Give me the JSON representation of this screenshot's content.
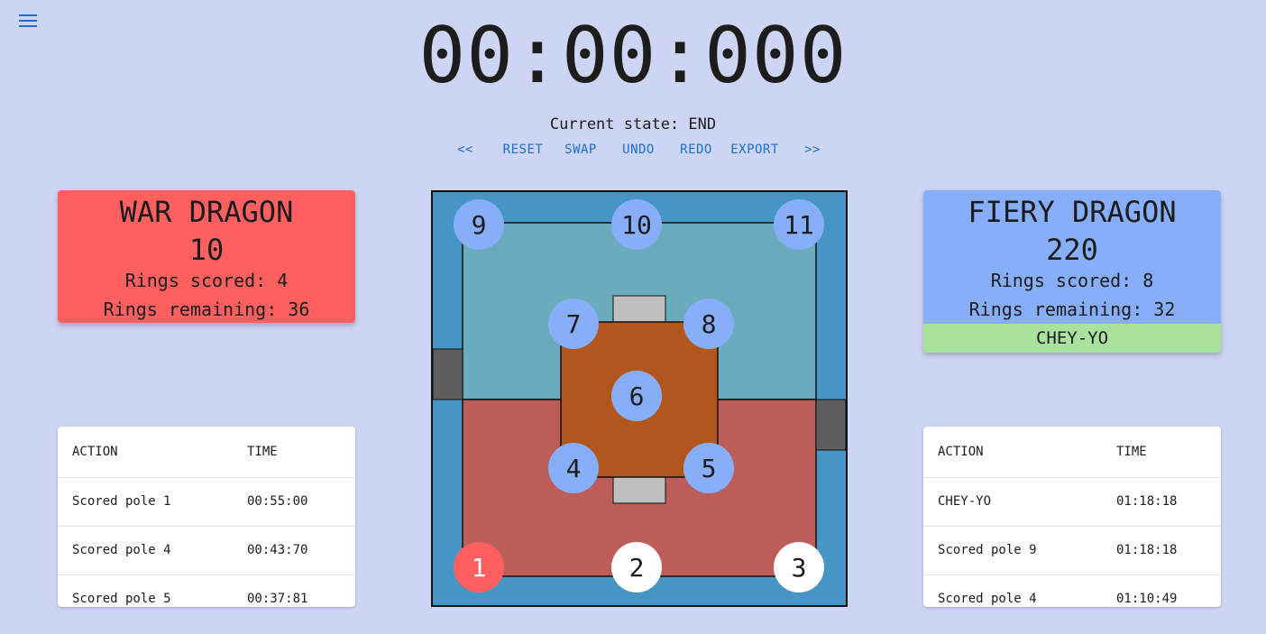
{
  "timer": "00:00:000",
  "state_text": "Current state: END",
  "controls": {
    "prev": "<<",
    "reset": "RESET",
    "swap": "SWAP",
    "undo": "UNDO",
    "redo": "REDO",
    "export": "EXPORT",
    "next": ">>"
  },
  "colors": {
    "background": "#cdd5f4",
    "red_team": "#fe5f5f",
    "blue_team": "#87aef8",
    "accent": "#1e6fce",
    "badge": "#a8e29c"
  },
  "menu_icon": "hamburger-menu-icon",
  "red_team": {
    "name": "WAR DRAGON",
    "score": "10",
    "rings_scored": "Rings scored: 4",
    "rings_remaining": "Rings remaining: 36"
  },
  "blue_team": {
    "name": "FIERY DRAGON",
    "score": "220",
    "rings_scored": "Rings scored: 8",
    "rings_remaining": "Rings remaining: 32",
    "badge": "CHEY-YO"
  },
  "red_log": {
    "headers": [
      "ACTION",
      "TIME"
    ],
    "rows": [
      [
        "Scored pole 1",
        "00:55:00"
      ],
      [
        "Scored pole 4",
        "00:43:70"
      ],
      [
        "Scored pole 5",
        "00:37:81"
      ]
    ]
  },
  "blue_log": {
    "headers": [
      "ACTION",
      "TIME"
    ],
    "rows": [
      [
        "CHEY-YO",
        "01:18:18"
      ],
      [
        "Scored pole 9",
        "01:18:18"
      ],
      [
        "Scored pole 4",
        "01:10:49"
      ]
    ]
  },
  "poles": [
    {
      "label": "1",
      "owner": "red"
    },
    {
      "label": "2",
      "owner": "none"
    },
    {
      "label": "3",
      "owner": "none"
    },
    {
      "label": "4",
      "owner": "blue"
    },
    {
      "label": "5",
      "owner": "blue"
    },
    {
      "label": "6",
      "owner": "blue"
    },
    {
      "label": "7",
      "owner": "blue"
    },
    {
      "label": "8",
      "owner": "blue"
    },
    {
      "label": "9",
      "owner": "blue"
    },
    {
      "label": "10",
      "owner": "blue"
    },
    {
      "label": "11",
      "owner": "blue"
    }
  ]
}
